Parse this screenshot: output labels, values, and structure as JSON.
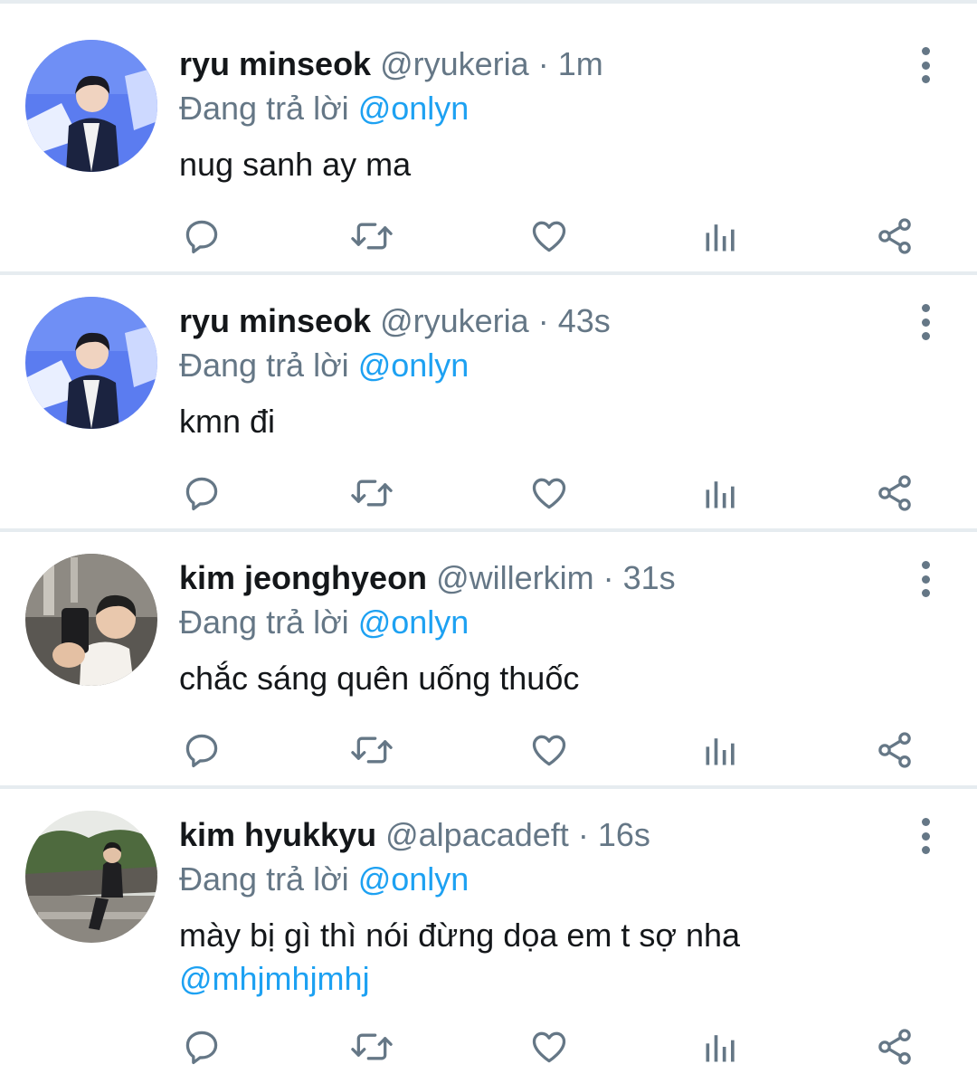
{
  "reply_prefix": "Đang trả lời",
  "dot": "·",
  "colors": {
    "text": "#14171a",
    "muted": "#657786",
    "accent": "#1da1f2",
    "divider": "#e6ecf0"
  },
  "actions": [
    "reply-icon",
    "retweet-icon",
    "like-icon",
    "analytics-icon",
    "share-icon"
  ],
  "tweets": [
    {
      "name": "ryu minseok",
      "handle": "@ryukeria",
      "time": "1m",
      "reply_to": "@onlyn",
      "text": "nug sanh ay ma",
      "mention": ""
    },
    {
      "name": "ryu minseok",
      "handle": "@ryukeria",
      "time": "43s",
      "reply_to": "@onlyn",
      "text": "kmn đi",
      "mention": ""
    },
    {
      "name": "kim jeonghyeon",
      "handle": "@willerkim",
      "time": "31s",
      "reply_to": "@onlyn",
      "text": "chắc sáng quên uống thuốc",
      "mention": ""
    },
    {
      "name": "kim hyukkyu",
      "handle": "@alpacadeft",
      "time": "16s",
      "reply_to": "@onlyn",
      "text": "mày bị gì thì nói đừng dọa em t sợ nha",
      "mention": "@mhjmhjmhj"
    }
  ]
}
